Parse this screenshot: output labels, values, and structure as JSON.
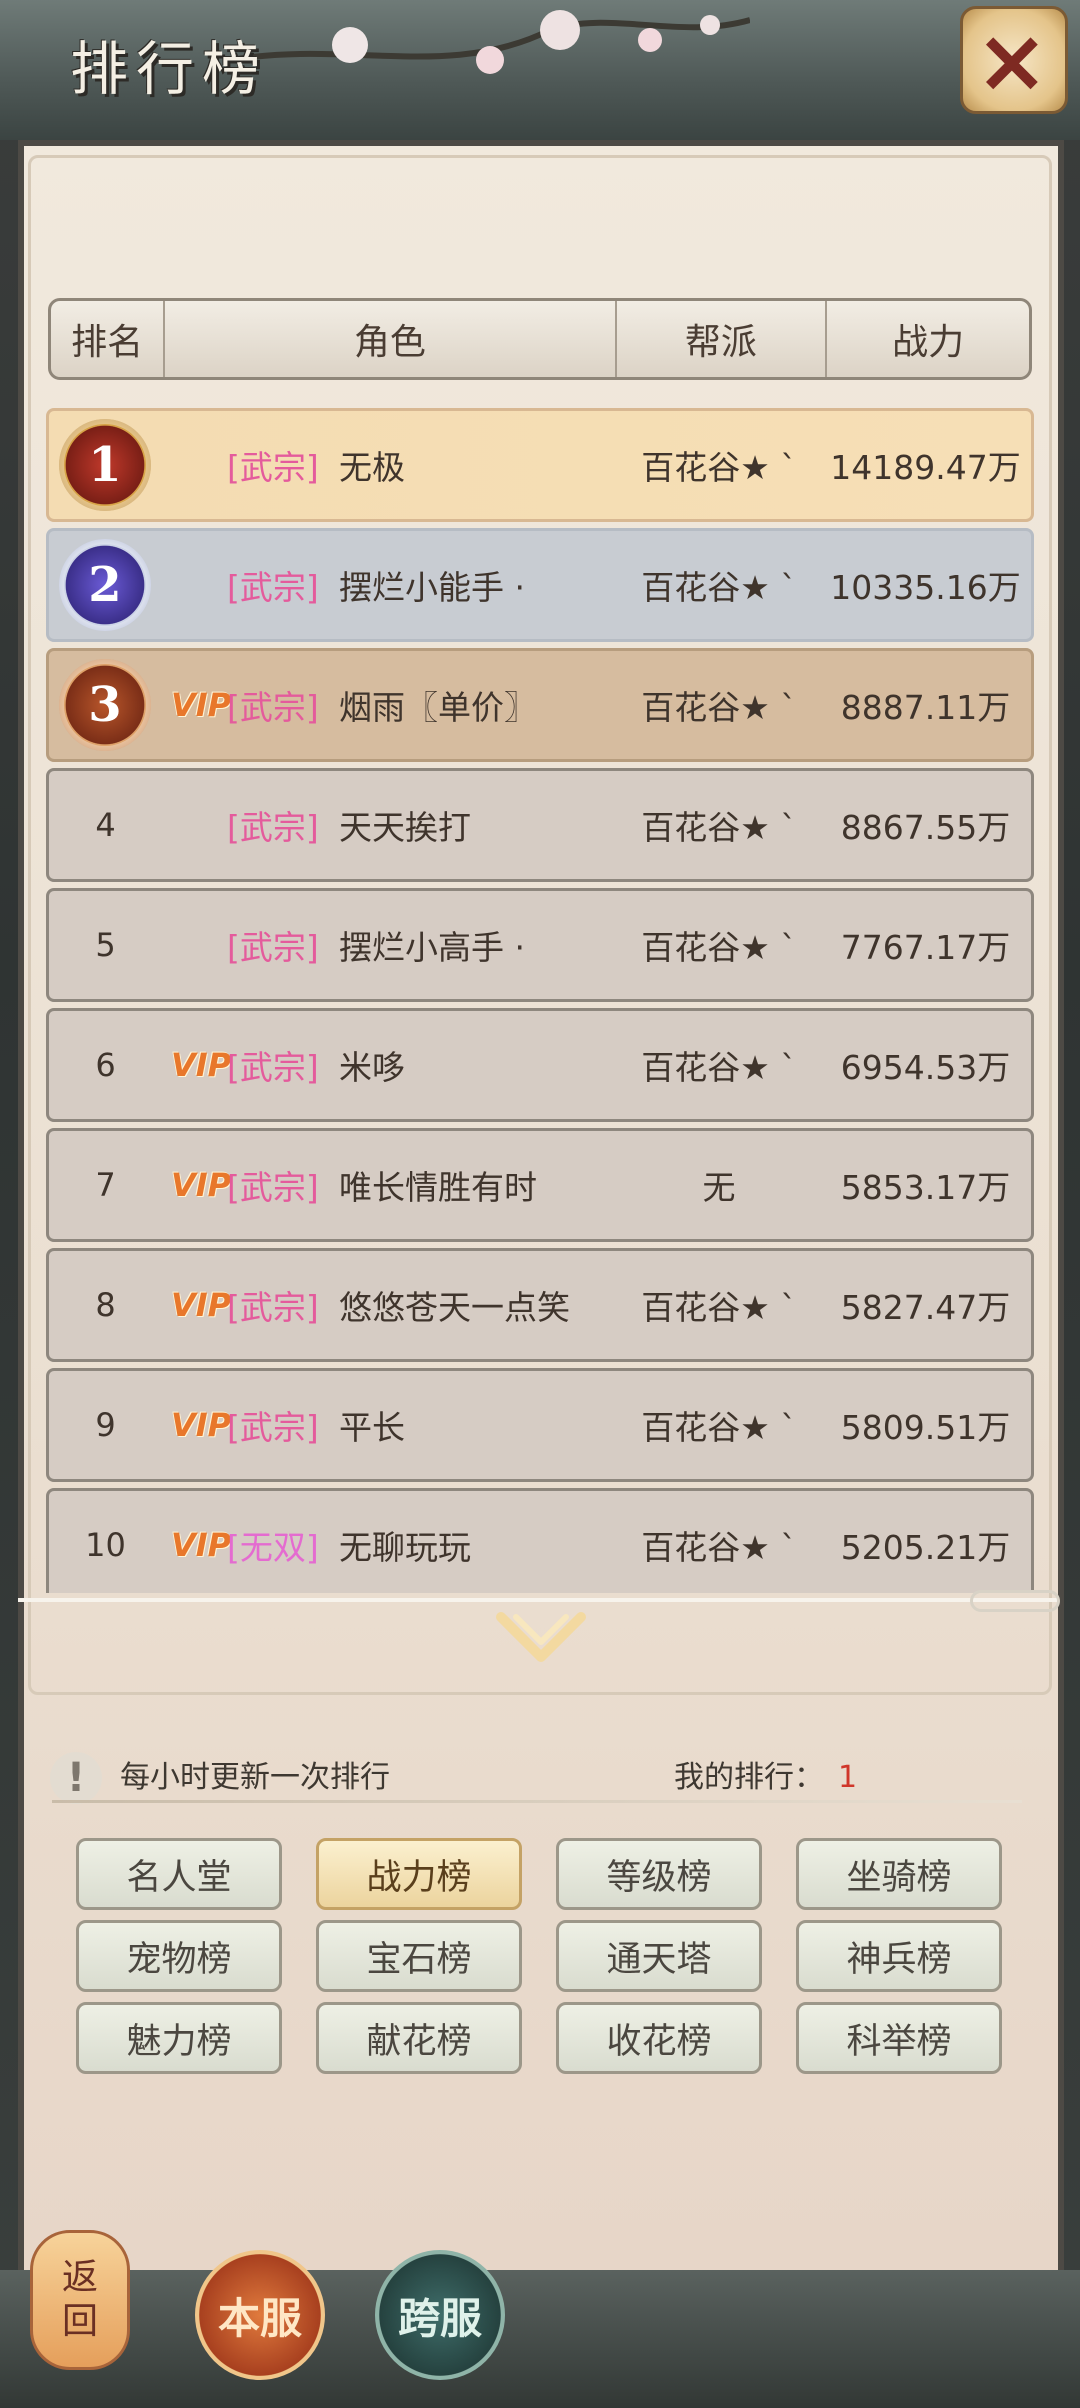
{
  "window": {
    "title": "排行榜",
    "close_label": "×"
  },
  "table": {
    "headers": {
      "rank": "排名",
      "role": "角色",
      "guild": "帮派",
      "power": "战力"
    },
    "rows": [
      {
        "rank": "1",
        "vip": "",
        "sect": "[武宗]",
        "name": "无极",
        "guild": "百花谷★ ˋ",
        "power": "14189.47万"
      },
      {
        "rank": "2",
        "vip": "",
        "sect": "[武宗]",
        "name": "摆烂小能手 ·",
        "guild": "百花谷★ ˋ",
        "power": "10335.16万"
      },
      {
        "rank": "3",
        "vip": "VIP",
        "sect": "[武宗]",
        "name": "烟雨〖单价〗",
        "guild": "百花谷★ ˋ",
        "power": "8887.11万"
      },
      {
        "rank": "4",
        "vip": "",
        "sect": "[武宗]",
        "name": "天天挨打",
        "guild": "百花谷★ ˋ",
        "power": "8867.55万"
      },
      {
        "rank": "5",
        "vip": "",
        "sect": "[武宗]",
        "name": "摆烂小高手 ·",
        "guild": "百花谷★ ˋ",
        "power": "7767.17万"
      },
      {
        "rank": "6",
        "vip": "VIP",
        "sect": "[武宗]",
        "name": "米哆",
        "guild": "百花谷★ ˋ",
        "power": "6954.53万"
      },
      {
        "rank": "7",
        "vip": "VIP",
        "sect": "[武宗]",
        "name": "唯长情胜有时",
        "guild": "无",
        "power": "5853.17万"
      },
      {
        "rank": "8",
        "vip": "VIP",
        "sect": "[武宗]",
        "name": "悠悠苍天一点笑",
        "guild": "百花谷★ ˋ",
        "power": "5827.47万"
      },
      {
        "rank": "9",
        "vip": "VIP",
        "sect": "[武宗]",
        "name": "平长",
        "guild": "百花谷★ ˋ",
        "power": "5809.51万"
      },
      {
        "rank": "10",
        "vip": "VIP",
        "sect": "[无双]",
        "name": "无聊玩玩",
        "guild": "百花谷★ ˋ",
        "power": "5205.21万"
      }
    ]
  },
  "footer": {
    "notice": "每小时更新一次排行",
    "my_rank_label": "我的排行：",
    "my_rank_value": "1"
  },
  "tabs": [
    {
      "label": "名人堂",
      "active": false
    },
    {
      "label": "战力榜",
      "active": true
    },
    {
      "label": "等级榜",
      "active": false
    },
    {
      "label": "坐骑榜",
      "active": false
    },
    {
      "label": "宠物榜",
      "active": false
    },
    {
      "label": "宝石榜",
      "active": false
    },
    {
      "label": "通天塔",
      "active": false
    },
    {
      "label": "神兵榜",
      "active": false
    },
    {
      "label": "魅力榜",
      "active": false
    },
    {
      "label": "献花榜",
      "active": false
    },
    {
      "label": "收花榜",
      "active": false
    },
    {
      "label": "科举榜",
      "active": false
    }
  ],
  "bottom_nav": {
    "back_line1": "返",
    "back_line2": "回",
    "local_server": "本服",
    "cross_server": "跨服"
  },
  "colors": {
    "accent": "#e45b9c",
    "vip": "#e8772b",
    "my_rank": "#d0362a"
  }
}
